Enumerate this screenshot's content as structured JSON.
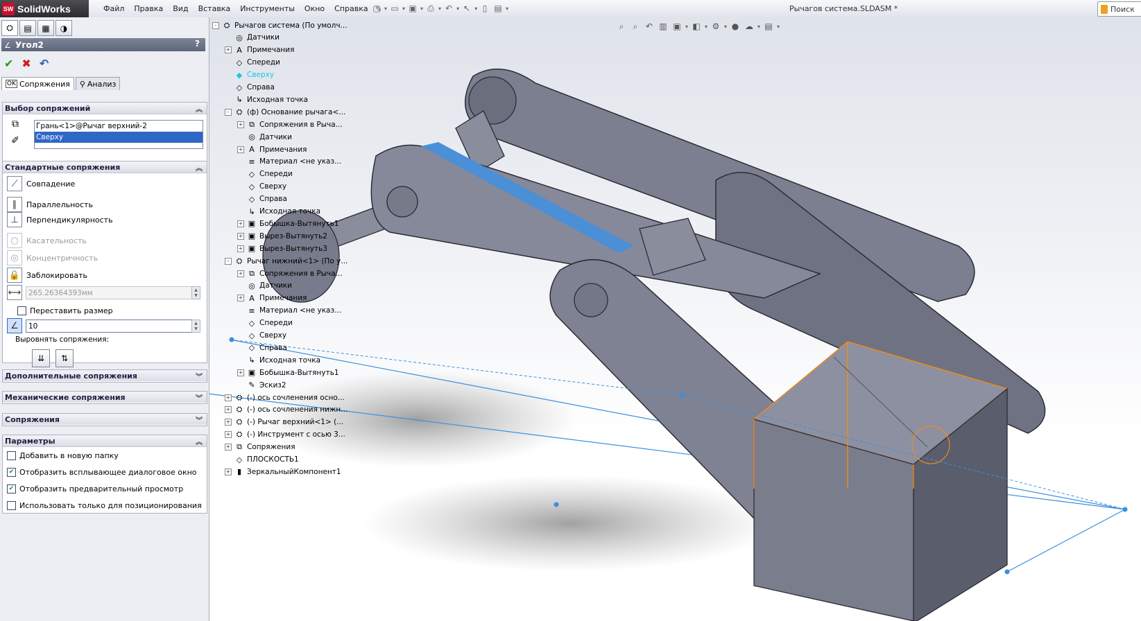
{
  "app": {
    "name": "SolidWorks",
    "doc_title": "Рычагов система.SLDASM *",
    "search_label": "Поиск"
  },
  "menu": [
    "Файл",
    "Правка",
    "Вид",
    "Вставка",
    "Инструменты",
    "Окно",
    "Справка"
  ],
  "property_manager": {
    "title": "Угол2",
    "help": "?",
    "tabs": [
      {
        "label": "Сопряжения",
        "badge": "OK"
      },
      {
        "label": "Анализ"
      }
    ],
    "mate_selections": {
      "header": "Выбор сопряжений",
      "items": [
        "Грань<1>@Рычаг верхний-2",
        "Сверху"
      ]
    },
    "standard_mates": {
      "header": "Стандартные сопряжения",
      "options": [
        {
          "label": "Совпадение",
          "enabled": true
        },
        {
          "label": "Параллельность",
          "enabled": true
        },
        {
          "label": "Перпендикулярность",
          "enabled": true
        },
        {
          "label": "Касательность",
          "enabled": false
        },
        {
          "label": "Концентричность",
          "enabled": false
        },
        {
          "label": "Заблокировать",
          "enabled": true
        }
      ],
      "distance_value": "265.26364393мм",
      "flip_dimension_label": "Переставить размер",
      "angle_value": "10",
      "align_label": "Выровнять сопряжения:"
    },
    "advanced_header": "Дополнительные сопряжения",
    "mechanical_header": "Механические сопряжения",
    "mates_header": "Сопряжения",
    "options": {
      "header": "Параметры",
      "items": [
        {
          "label": "Добавить в новую папку",
          "checked": false
        },
        {
          "label": "Отобразить всплывающее диалоговое окно",
          "checked": true
        },
        {
          "label": "Отобразить предварительный просмотр",
          "checked": true
        },
        {
          "label": "Использовать только для позиционирования",
          "checked": false
        }
      ]
    }
  },
  "feature_tree": [
    {
      "label": "Рычагов система  (По умолч...",
      "level": 0,
      "exp": "-",
      "icon": "⛭"
    },
    {
      "label": "Датчики",
      "level": 1,
      "exp": "",
      "icon": "◎"
    },
    {
      "label": "Примечания",
      "level": 1,
      "exp": "+",
      "icon": "A"
    },
    {
      "label": "Спереди",
      "level": 1,
      "exp": "",
      "icon": "◇"
    },
    {
      "label": "Сверху",
      "level": 1,
      "exp": "",
      "icon": "◆",
      "highlight": true
    },
    {
      "label": "Справа",
      "level": 1,
      "exp": "",
      "icon": "◇"
    },
    {
      "label": "Исходная точка",
      "level": 1,
      "exp": "",
      "icon": "↳"
    },
    {
      "label": "(ф) Основание рычага<...",
      "level": 1,
      "exp": "-",
      "icon": "⛭"
    },
    {
      "label": "Сопряжения в Рыча...",
      "level": 2,
      "exp": "+",
      "icon": "⧉"
    },
    {
      "label": "Датчики",
      "level": 2,
      "exp": "",
      "icon": "◎"
    },
    {
      "label": "Примечания",
      "level": 2,
      "exp": "+",
      "icon": "A"
    },
    {
      "label": "Материал <не указ...",
      "level": 2,
      "exp": "",
      "icon": "≡"
    },
    {
      "label": "Спереди",
      "level": 2,
      "exp": "",
      "icon": "◇"
    },
    {
      "label": "Сверху",
      "level": 2,
      "exp": "",
      "icon": "◇"
    },
    {
      "label": "Справа",
      "level": 2,
      "exp": "",
      "icon": "◇"
    },
    {
      "label": "Исходная точка",
      "level": 2,
      "exp": "",
      "icon": "↳"
    },
    {
      "label": "Бобышка-Вытянуть1",
      "level": 2,
      "exp": "+",
      "icon": "▣"
    },
    {
      "label": "Вырез-Вытянуть2",
      "level": 2,
      "exp": "+",
      "icon": "▣"
    },
    {
      "label": "Вырез-Вытянуть3",
      "level": 2,
      "exp": "+",
      "icon": "▣"
    },
    {
      "label": "Рычаг нижний<1> (По у...",
      "level": 1,
      "exp": "-",
      "icon": "⛭"
    },
    {
      "label": "Сопряжения в Рыча...",
      "level": 2,
      "exp": "+",
      "icon": "⧉"
    },
    {
      "label": "Датчики",
      "level": 2,
      "exp": "",
      "icon": "◎"
    },
    {
      "label": "Примечания",
      "level": 2,
      "exp": "+",
      "icon": "A"
    },
    {
      "label": "Материал <не указ...",
      "level": 2,
      "exp": "",
      "icon": "≡"
    },
    {
      "label": "Спереди",
      "level": 2,
      "exp": "",
      "icon": "◇"
    },
    {
      "label": "Сверху",
      "level": 2,
      "exp": "",
      "icon": "◇"
    },
    {
      "label": "Справа",
      "level": 2,
      "exp": "",
      "icon": "◇"
    },
    {
      "label": "Исходная точка",
      "level": 2,
      "exp": "",
      "icon": "↳"
    },
    {
      "label": "Бобышка-Вытянуть1",
      "level": 2,
      "exp": "+",
      "icon": "▣"
    },
    {
      "label": "Эскиз2",
      "level": 2,
      "exp": "",
      "icon": "✎"
    },
    {
      "label": "(-) ось сочленения осно...",
      "level": 1,
      "exp": "+",
      "icon": "⛭"
    },
    {
      "label": "(-) ось сочленения нижн...",
      "level": 1,
      "exp": "+",
      "icon": "⛭"
    },
    {
      "label": "(-) Рычаг верхний<1> (...",
      "level": 1,
      "exp": "+",
      "icon": "⛭"
    },
    {
      "label": "(-) Инструмент с осью 3...",
      "level": 1,
      "exp": "+",
      "icon": "⛭"
    },
    {
      "label": "Сопряжения",
      "level": 1,
      "exp": "+",
      "icon": "⧉"
    },
    {
      "label": "ПЛОСКОСТЬ1",
      "level": 1,
      "exp": "",
      "icon": "◇"
    },
    {
      "label": "ЗеркальныйКомпонент1",
      "level": 1,
      "exp": "+",
      "icon": "▮"
    }
  ],
  "colors": {
    "accent": "#2f67c6",
    "selection_edge": "#f08a1c",
    "preview_line": "#3b8fe0",
    "tree_highlight": "#19c7e6"
  }
}
